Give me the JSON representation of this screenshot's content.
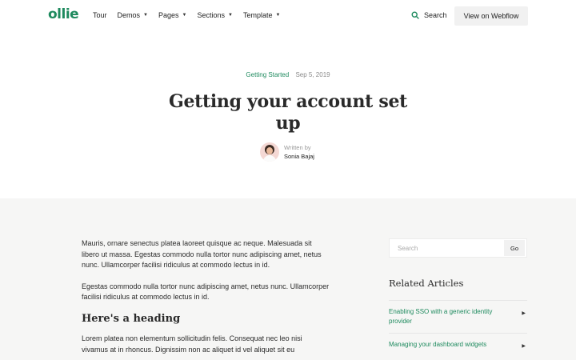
{
  "nav": {
    "logo": "ollie",
    "links": [
      {
        "label": "Tour",
        "dropdown": false
      },
      {
        "label": "Demos",
        "dropdown": true
      },
      {
        "label": "Pages",
        "dropdown": true
      },
      {
        "label": "Sections",
        "dropdown": true
      },
      {
        "label": "Template",
        "dropdown": true
      }
    ],
    "search_label": "Search",
    "cta_label": "View on Webflow",
    "caret": "▼"
  },
  "hero": {
    "category": "Getting Started",
    "date": "Sep 5, 2019",
    "title": "Getting your account set up",
    "written_by": "Written by",
    "author": "Sonia Bajaj"
  },
  "article": {
    "paragraphs": [
      "Mauris, ornare senectus platea laoreet quisque ac neque. Malesuada sit libero ut massa. Egestas commodo nulla tortor nunc adipiscing amet, netus nunc. Ullamcorper facilisi ridiculus at commodo lectus in id.",
      "Egestas commodo nulla tortor nunc adipiscing amet, netus nunc. Ullamcorper facilisi ridiculus at commodo lectus in id."
    ],
    "heading": "Here's a heading",
    "paragraph_after_heading": "Lorem platea non elementum sollicitudin felis. Consequat nec leo nisi vivamus at in rhoncus. Dignissim non ac aliquet id vel aliquet sit eu"
  },
  "sidebar": {
    "search_placeholder": "Search",
    "go_label": "Go",
    "related_title": "Related Articles",
    "related": [
      "Enabling SSO with a generic identity provider",
      "Managing your dashboard widgets"
    ],
    "arrow": "▶"
  },
  "colors": {
    "accent": "#1e8a5e",
    "content_bg": "#f6f6f5"
  }
}
